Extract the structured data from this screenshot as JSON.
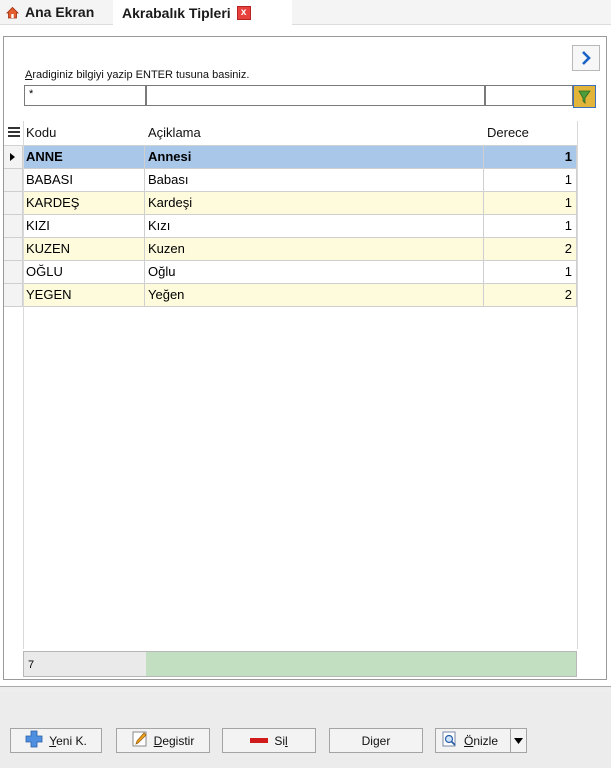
{
  "tabs": {
    "home_label": "Ana Ekran",
    "active_label": "Akrabalık Tipleri",
    "close_glyph": "x"
  },
  "search": {
    "hint_prefix": "A",
    "hint_rest": "radiginiz bilgiyi yazip ENTER tusuna basiniz.",
    "value": "*"
  },
  "grid": {
    "columns": [
      "Kodu",
      "Açiklama",
      "Derece"
    ],
    "rows": [
      {
        "kodu": "ANNE",
        "aciklama": "Annesi",
        "derece": "1"
      },
      {
        "kodu": "BABASI",
        "aciklama": "Babası",
        "derece": "1"
      },
      {
        "kodu": "KARDEŞ",
        "aciklama": "Kardeşi",
        "derece": "1"
      },
      {
        "kodu": "KIZI",
        "aciklama": "Kızı",
        "derece": "1"
      },
      {
        "kodu": "KUZEN",
        "aciklama": "Kuzen",
        "derece": "2"
      },
      {
        "kodu": "OĞLU",
        "aciklama": "Oğlu",
        "derece": "1"
      },
      {
        "kodu": "YEGEN",
        "aciklama": "Yeğen",
        "derece": "2"
      }
    ],
    "selected_index": 0,
    "record_count": "7"
  },
  "toolbar": {
    "new_first": "Y",
    "new_rest": "eni K.",
    "edit_first": "D",
    "edit_rest": "egistir",
    "delete_pre": "Si",
    "delete_under": "l",
    "other_pre": "Di",
    "other_under": "g",
    "other_post": "er",
    "preview_first": "Ö",
    "preview_rest": "nizle"
  },
  "colors": {
    "selected_row": "#a9c8e9",
    "alt_row": "#fdfbdc",
    "footer_bar": "#c3dfc2",
    "accent_blue": "#1a63c6"
  }
}
